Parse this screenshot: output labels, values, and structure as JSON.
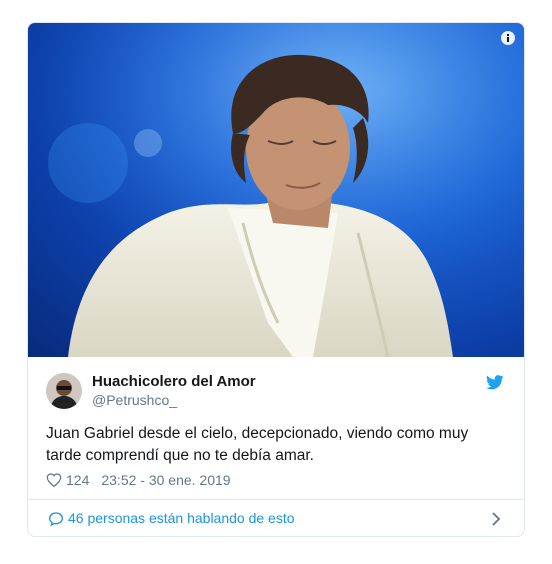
{
  "tweet": {
    "display_name": "Huachicolero del Amor",
    "handle": "@Petrushco_",
    "text": "Juan Gabriel desde el cielo, decepcionado, viendo como muy tarde comprendí que no te debía amar.",
    "likes": "124",
    "timestamp": "23:52 - 30 ene. 2019",
    "conversation": "46 personas están hablando de esto"
  },
  "icons": {
    "info": "info-icon",
    "twitter": "twitter-bird-icon",
    "like": "heart-icon",
    "reply": "speech-bubble-icon",
    "chevron": "chevron-right-icon"
  },
  "colors": {
    "accent": "#1da1f2",
    "link": "#1b95e0",
    "muted": "#657786",
    "border": "#e1e8ed"
  }
}
